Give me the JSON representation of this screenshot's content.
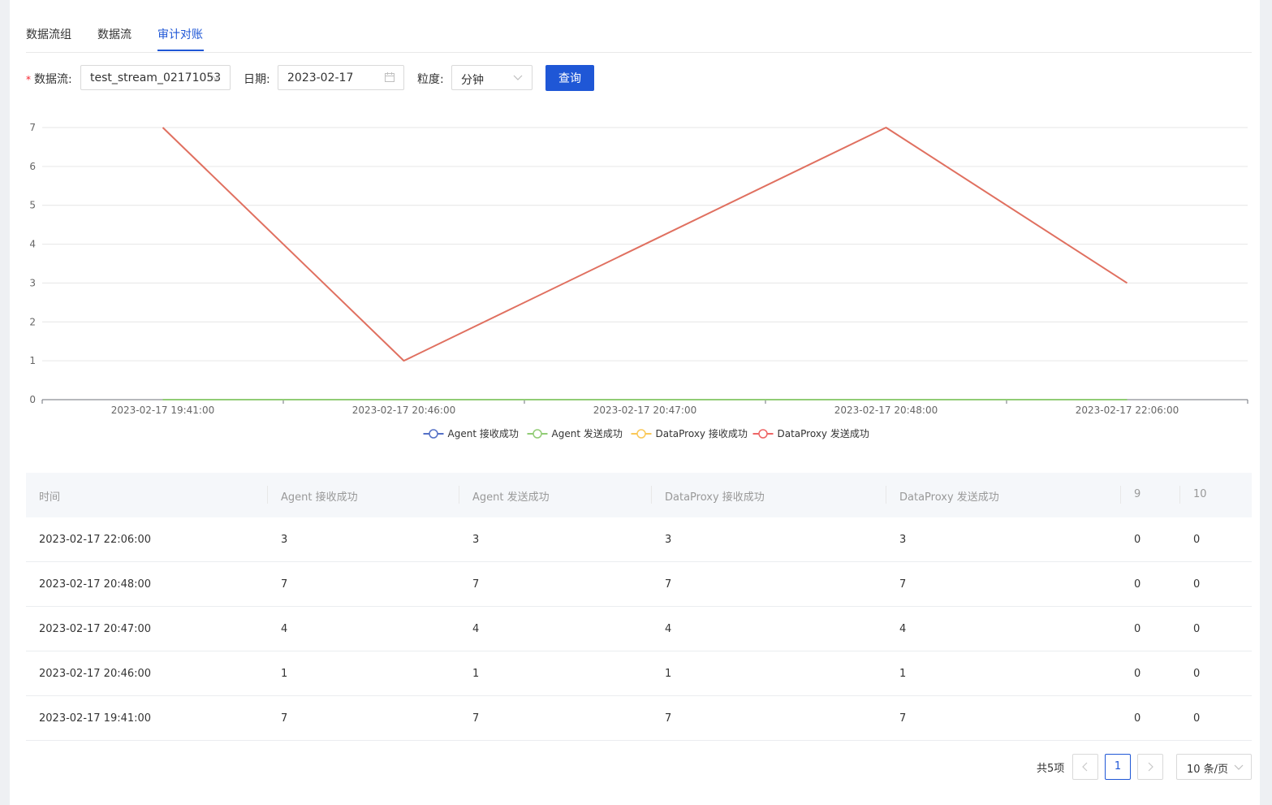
{
  "tabs": [
    {
      "label": "数据流组"
    },
    {
      "label": "数据流"
    },
    {
      "label": "审计对账"
    }
  ],
  "form": {
    "stream_label": "数据流",
    "stream_value": "test_stream_02171053",
    "date_label": "日期",
    "date_value": "2023-02-17",
    "granularity_label": "粒度",
    "granularity_value": "分钟",
    "query_button": "查询"
  },
  "chart_data": {
    "type": "line",
    "x": [
      "2023-02-17 19:41:00",
      "2023-02-17 20:46:00",
      "2023-02-17 20:47:00",
      "2023-02-17 20:48:00",
      "2023-02-17 22:06:00"
    ],
    "y_ticks": [
      "0",
      "1",
      "2",
      "3",
      "4",
      "5",
      "6",
      "7"
    ],
    "ylim": [
      0,
      7
    ],
    "grid": true,
    "legend_position": "bottom-center",
    "series": [
      {
        "name": "Agent 接收成功",
        "color": "#5470c6",
        "values": [
          0,
          0,
          0,
          0,
          0
        ]
      },
      {
        "name": "Agent 发送成功",
        "color": "#91cc75",
        "values": [
          0,
          0,
          0,
          0,
          0
        ]
      },
      {
        "name": "DataProxy 接收成功",
        "color": "#fac858",
        "values": [
          0,
          0,
          0,
          0,
          0
        ]
      },
      {
        "name": "DataProxy 发送成功",
        "color": "#ee6666",
        "values": [
          7,
          1,
          4,
          7,
          3
        ]
      }
    ]
  },
  "table": {
    "headers": [
      "时间",
      "Agent 接收成功",
      "Agent 发送成功",
      "DataProxy 接收成功",
      "DataProxy 发送成功",
      "9",
      "10"
    ],
    "rows": [
      [
        "2023-02-17 22:06:00",
        "3",
        "3",
        "3",
        "3",
        "0",
        "0"
      ],
      [
        "2023-02-17 20:48:00",
        "7",
        "7",
        "7",
        "7",
        "0",
        "0"
      ],
      [
        "2023-02-17 20:47:00",
        "4",
        "4",
        "4",
        "4",
        "0",
        "0"
      ],
      [
        "2023-02-17 20:46:00",
        "1",
        "1",
        "1",
        "1",
        "0",
        "0"
      ],
      [
        "2023-02-17 19:41:00",
        "7",
        "7",
        "7",
        "7",
        "0",
        "0"
      ]
    ]
  },
  "pagination": {
    "total": "共5项",
    "current": "1",
    "page_size": "10 条/页"
  }
}
